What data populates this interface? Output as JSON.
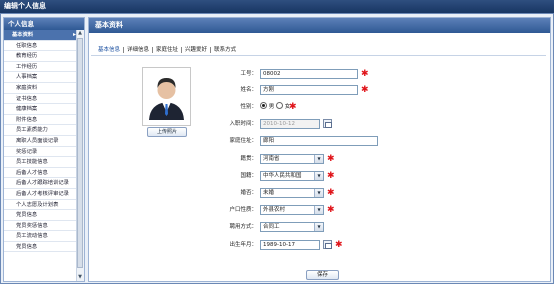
{
  "window": {
    "title": "编辑个人信息"
  },
  "sidebar": {
    "title": "个人信息",
    "active_arrow": "▸",
    "items": [
      {
        "label": "基本资料"
      },
      {
        "label": "任职信息"
      },
      {
        "label": "教育经历"
      },
      {
        "label": "工作经历"
      },
      {
        "label": "人事档案"
      },
      {
        "label": "家庭资料"
      },
      {
        "label": "证书信息"
      },
      {
        "label": "健康档案"
      },
      {
        "label": "附件信息"
      },
      {
        "label": "员工素质能力"
      },
      {
        "label": "离职人员面谈记录"
      },
      {
        "label": "奖惩记录"
      },
      {
        "label": "员工技能信息"
      },
      {
        "label": "后备人才信息"
      },
      {
        "label": "后备人才跟踪培训记录"
      },
      {
        "label": "后备人才考核评审记录"
      },
      {
        "label": "个人志愿及计划表"
      },
      {
        "label": "党员信息"
      },
      {
        "label": "党员奖惩信息"
      },
      {
        "label": "员工流动信息"
      },
      {
        "label": "党员信息"
      }
    ]
  },
  "panel": {
    "title": "基本资料",
    "tabs": [
      {
        "label": "基本信息",
        "active": true
      },
      {
        "label": "详细信息",
        "active": false
      },
      {
        "label": "家庭住址",
        "active": false
      },
      {
        "label": "兴趣爱好",
        "active": false
      },
      {
        "label": "联系方式",
        "active": false
      }
    ],
    "upload_label": "上传照片",
    "save_label": "保存"
  },
  "form": {
    "emp_no": {
      "label": "工号：",
      "value": "08002"
    },
    "name": {
      "label": "姓名：",
      "value": "方刚"
    },
    "gender": {
      "label": "性别：",
      "male": "男",
      "female": "女",
      "selected": "男"
    },
    "hire_date": {
      "label": "入职时间：",
      "value": "2010-10-12"
    },
    "address": {
      "label": "家庭住址：",
      "value": "廊阳"
    },
    "native": {
      "label": "籍贯：",
      "value": "河南省"
    },
    "nationality": {
      "label": "国籍：",
      "value": "中华人民共和国"
    },
    "marital": {
      "label": "婚否：",
      "value": "未婚"
    },
    "hukou": {
      "label": "户口性质：",
      "value": "外县农村"
    },
    "employ_type": {
      "label": "聘用方式：",
      "value": "合同工"
    },
    "birth": {
      "label": "出生年月：",
      "value": "1989-10-17"
    }
  },
  "colors": {
    "required": "#e0151b",
    "header": "#2f5994"
  },
  "required_mark": "✱"
}
